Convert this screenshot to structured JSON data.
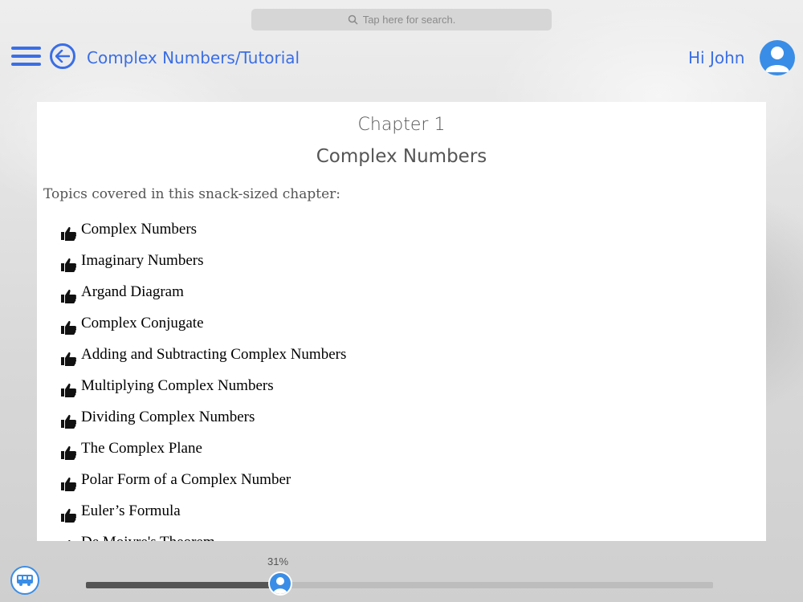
{
  "search": {
    "placeholder": "Tap here for search."
  },
  "header": {
    "breadcrumb": "Complex Numbers/Tutorial",
    "greeting": "Hi John",
    "menu_icon": "hamburger-icon",
    "back_icon": "back-arrow-icon",
    "avatar_icon": "user-avatar-icon"
  },
  "content": {
    "chapter": "Chapter 1",
    "title": "Complex Numbers",
    "intro": "Topics covered in this snack-sized chapter:",
    "topic_icon": "thumbs-up-icon",
    "topics": [
      "Complex Numbers",
      "Imaginary Numbers",
      "Argand Diagram",
      "Complex Conjugate",
      "Adding and Subtracting Complex Numbers",
      "Multiplying Complex Numbers",
      "Dividing Complex Numbers",
      "The Complex Plane",
      "Polar Form of a Complex Number",
      "Euler’s Formula",
      "De Moivre's Theorem"
    ]
  },
  "footer": {
    "progress_label": "31%",
    "progress": 0.31,
    "bus_icon": "bus-icon"
  },
  "colors": {
    "accent": "#3a6ee6",
    "avatar": "#3a8de6"
  }
}
